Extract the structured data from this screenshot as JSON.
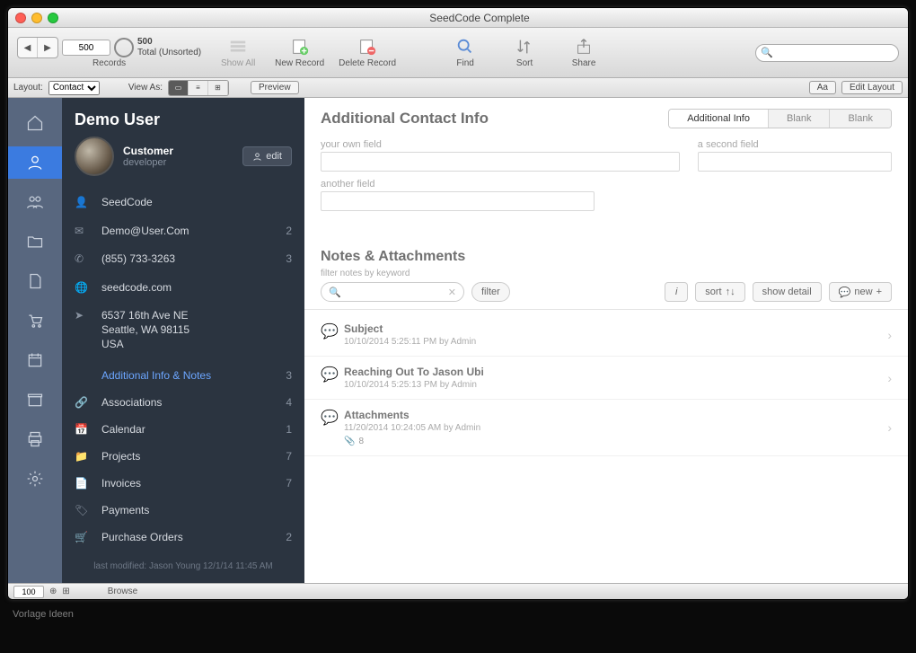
{
  "window": {
    "title": "SeedCode Complete"
  },
  "toolbar": {
    "record_field": "500",
    "total_count": "500",
    "total_label": "Total (Unsorted)",
    "records_label": "Records",
    "show_all": "Show All",
    "new_record": "New Record",
    "delete_record": "Delete Record",
    "find": "Find",
    "sort": "Sort",
    "share": "Share",
    "search_placeholder": ""
  },
  "layoutbar": {
    "layout_label": "Layout:",
    "layout_value": "Contact",
    "viewas_label": "View As:",
    "preview": "Preview",
    "aa": "Aa",
    "edit_layout": "Edit Layout"
  },
  "contact": {
    "name": "Demo User",
    "role": "Customer",
    "subrole": "developer",
    "edit": "edit",
    "company": "SeedCode",
    "email": "Demo@User.Com",
    "email_count": "2",
    "phone": "(855) 733-3263",
    "phone_count": "3",
    "website": "seedcode.com",
    "address": "6537 16th Ave NE\nSeattle, WA 98115\nUSA"
  },
  "nav": [
    {
      "label": "Additional Info & Notes",
      "count": "3",
      "active": true
    },
    {
      "label": "Associations",
      "count": "4"
    },
    {
      "label": "Calendar",
      "count": "1"
    },
    {
      "label": "Projects",
      "count": "7"
    },
    {
      "label": "Invoices",
      "count": "7"
    },
    {
      "label": "Payments",
      "count": ""
    },
    {
      "label": "Purchase Orders",
      "count": "2"
    }
  ],
  "last_modified": "last modified: Jason Young 12/1/14 11:45 AM",
  "detail": {
    "heading": "Additional Contact Info",
    "tabs": [
      "Additional Info",
      "Blank",
      "Blank"
    ],
    "field1_label": "your own field",
    "field2_label": "a second field",
    "field3_label": "another field"
  },
  "notes_section": {
    "heading": "Notes & Attachments",
    "filter_label": "filter notes by keyword",
    "filter_btn": "filter",
    "info_btn": "i",
    "sort_btn": "sort",
    "detail_btn": "show detail",
    "new_btn": "new"
  },
  "notes": [
    {
      "subject": "Subject",
      "meta": "10/10/2014 5:25:11 PM by Admin"
    },
    {
      "subject": "Reaching Out To Jason Ubi",
      "meta": "10/10/2014 5:25:13 PM by Admin"
    },
    {
      "subject": "Attachments",
      "meta": "11/20/2014 10:24:05 AM by Admin",
      "attach": "8"
    }
  ],
  "statusbar": {
    "zoom": "100",
    "mode": "Browse"
  },
  "credit": "Vorlage Ideen"
}
